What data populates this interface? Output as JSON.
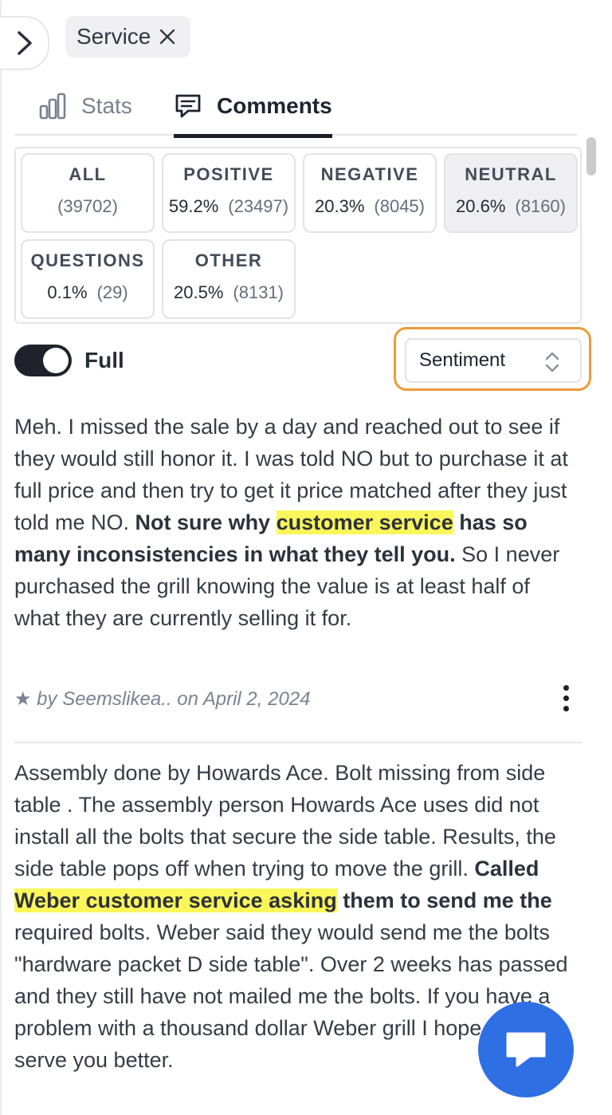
{
  "filter_chip": {
    "label": "Service"
  },
  "tabs": [
    {
      "label": "Stats",
      "active": false
    },
    {
      "label": "Comments",
      "active": true
    }
  ],
  "filters": [
    {
      "name": "ALL",
      "percent": "",
      "count": "(39702)",
      "selected": false
    },
    {
      "name": "POSITIVE",
      "percent": "59.2%",
      "count": "(23497)",
      "selected": false
    },
    {
      "name": "NEGATIVE",
      "percent": "20.3%",
      "count": "(8045)",
      "selected": false
    },
    {
      "name": "NEUTRAL",
      "percent": "20.6%",
      "count": "(8160)",
      "selected": true
    },
    {
      "name": "QUESTIONS",
      "percent": "0.1%",
      "count": "(29)",
      "selected": false
    },
    {
      "name": "OTHER",
      "percent": "20.5%",
      "count": "(8131)",
      "selected": false
    }
  ],
  "toggle": {
    "label": "Full",
    "on": true
  },
  "sort_select": {
    "value": "Sentiment"
  },
  "comments": [
    {
      "parts": [
        {
          "text": "Meh. I missed the sale by a day and reached out to see if they would still honor it. I was told NO but to purchase it at full price and then try to get it price matched after they just told me NO.  "
        },
        {
          "bold": true,
          "segments": [
            {
              "text": "Not sure why "
            },
            {
              "text": "customer service",
              "highlight": true
            },
            {
              "text": " has so many inconsistencies in what they tell you."
            }
          ]
        },
        {
          "text": " So I never purchased the grill knowing the value is at least half of what they are currently selling it for."
        }
      ],
      "meta": "★ by Seemslikea.. on April 2, 2024"
    },
    {
      "parts": [
        {
          "text": "Assembly done by Howards Ace. Bolt missing from side table . The assembly person Howards Ace uses did not install all the bolts that secure the side table. Results, the side table pops off when trying to move the grill.  "
        },
        {
          "bold": true,
          "segments": [
            {
              "text": "Called "
            },
            {
              "text": "Weber customer service asking",
              "highlight": true
            },
            {
              "text": " them to send me the"
            }
          ]
        },
        {
          "text": " required bolts. Weber said they would send me the bolts \"hardware packet D side table\". Over 2 weeks has passed and they still have not mailed me the bolts. If you have a problem with a thousand dollar Weber grill I hope they serve you better."
        }
      ]
    }
  ],
  "icons": {
    "expand": "chevron-right-icon",
    "remove_chip": "close-icon",
    "stats": "bar-chart-icon",
    "comments": "message-square-icon",
    "select": "chevron-up-down-icon",
    "more": "more-vertical-icon",
    "chat": "chat-bubble-icon"
  },
  "colors": {
    "highlight": "#fbf75a",
    "focus_ring": "#ee9a3a",
    "chat_button": "#2f6fe4"
  }
}
